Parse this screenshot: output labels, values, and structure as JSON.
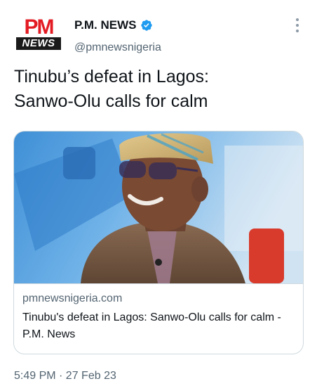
{
  "header": {
    "avatar_logo_top": "PM",
    "avatar_logo_bottom": "NEWS",
    "display_name": "P.M. NEWS",
    "handle": "@pmnewsnigeria",
    "verified_icon": "verified-badge-icon",
    "more_icon": "more-vertical-icon"
  },
  "tweet": {
    "text": "Tinubu’s defeat in Lagos:\nSanwo-Olu calls for calm"
  },
  "card": {
    "domain": "pmnewsnigeria.com",
    "title": "Tinubu's defeat in Lagos: Sanwo-Olu calls for calm - P.M. News"
  },
  "meta": {
    "timestamp": "5:49 PM · 27 Feb 23"
  },
  "colors": {
    "brand_red": "#e31b23",
    "verified_blue": "#1d9bf0",
    "secondary_text": "#536471",
    "border": "#cfd9de"
  }
}
